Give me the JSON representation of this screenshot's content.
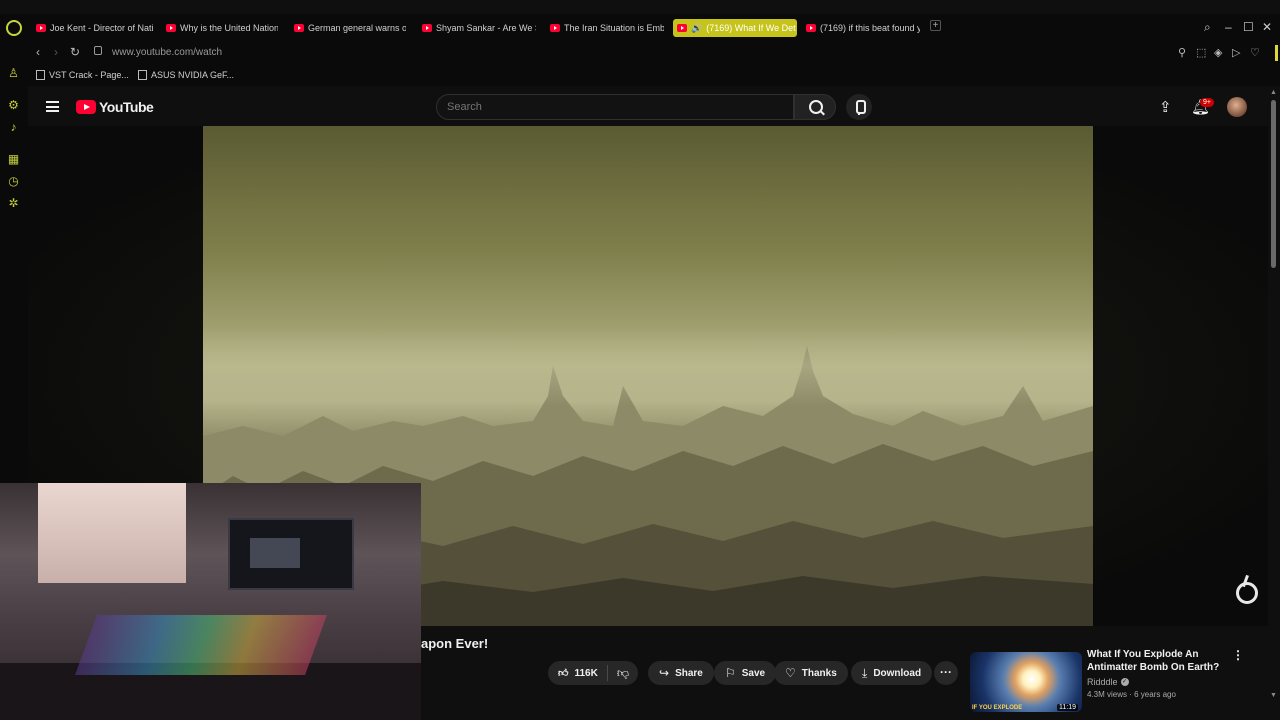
{
  "browser": {
    "tabs": [
      {
        "label": "Joe Kent - Director of Nati",
        "active": false
      },
      {
        "label": "Why is the United Nations",
        "active": false
      },
      {
        "label": "German general warns of",
        "active": false
      },
      {
        "label": "Shyam Sankar - Are We Sl",
        "active": false
      },
      {
        "label": "The Iran Situation is Emba",
        "active": false
      },
      {
        "label": "(7169) What If We Det",
        "active": true
      },
      {
        "label": "(7169) if this beat found yo",
        "active": false
      }
    ],
    "new_tab_label": "+",
    "url": "www.youtube.com/watch",
    "bookmarks": [
      {
        "label": "VST Crack - Page..."
      },
      {
        "label": "ASUS NVIDIA GeF..."
      }
    ],
    "accent_color": "#c6c31a"
  },
  "youtube": {
    "logo_text": "YouTube",
    "search_placeholder": "Search",
    "notification_badge": "9+"
  },
  "video": {
    "title_visible": "apon Ever!",
    "likes": "116K",
    "actions": {
      "share": "Share",
      "save": "Save",
      "thanks": "Thanks",
      "download": "Download"
    }
  },
  "recommendation": {
    "title": "What If You Explode An Antimatter Bomb On Earth?",
    "channel": "Ridddle",
    "meta": "4.3M views · 6 years ago",
    "duration": "11:19",
    "thumb_caption": "IF YOU EXPLODE"
  }
}
